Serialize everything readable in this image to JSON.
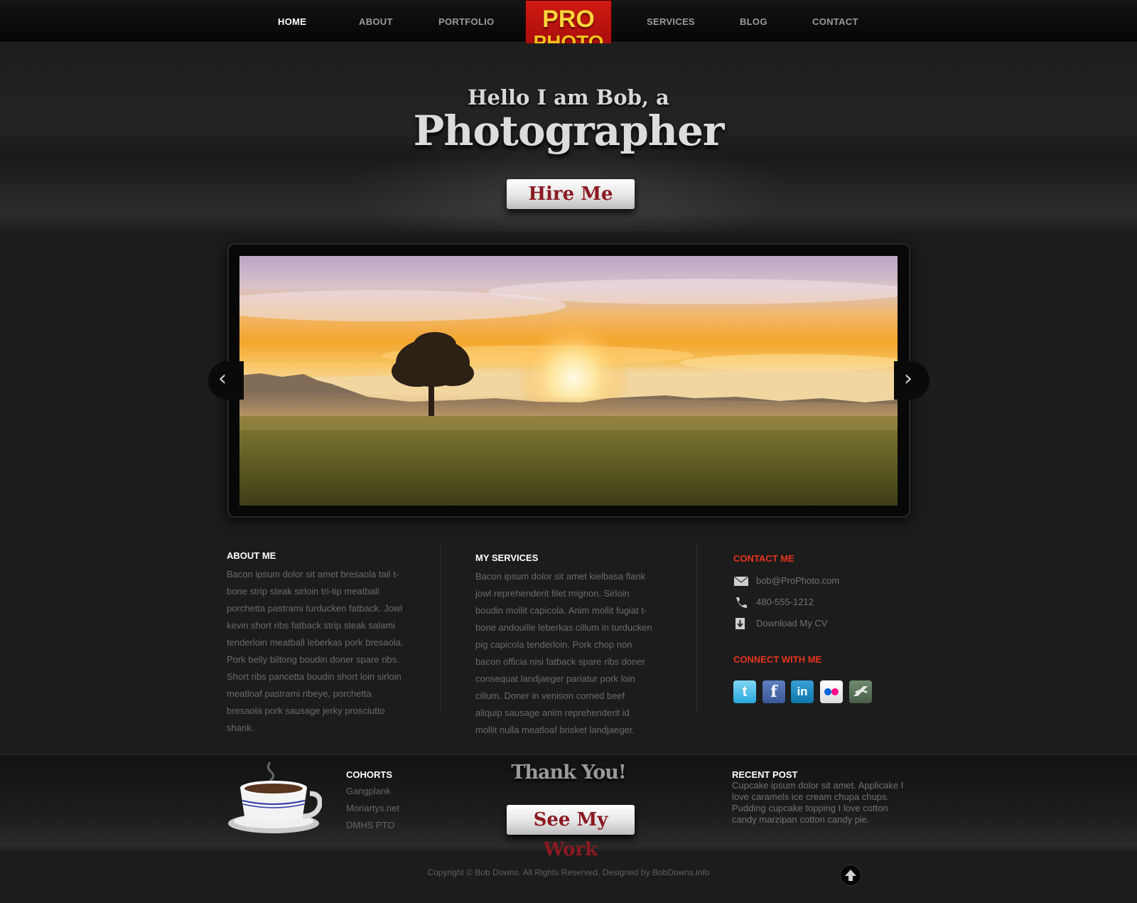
{
  "nav": {
    "items": [
      {
        "label": "HOME"
      },
      {
        "label": "ABOUT"
      },
      {
        "label": "PORTFOLIO"
      },
      {
        "label": "SERVICES"
      },
      {
        "label": "BLOG"
      },
      {
        "label": "CONTACT"
      }
    ],
    "active": "HOME"
  },
  "logo": {
    "line1": "PRO",
    "line2": "PHOTO"
  },
  "hero": {
    "line1": "Hello I am Bob, a",
    "line2": "Photographer",
    "cta": "Hire Me"
  },
  "slider": {
    "prev_icon": "chevron-left-icon",
    "next_icon": "chevron-right-icon"
  },
  "about": {
    "heading": "ABOUT ME",
    "text": "Bacon ipsum dolor sit amet bresaola tail t-bone strip steak sirloin tri-tip meatball porchetta pastrami turducken fatback. Jowl kevin short ribs fatback strip steak salami tenderloin meatball leberkas pork bresaola. Pork belly biltong boudin doner spare ribs. Short ribs pancetta boudin short loin sirloin meatloaf pastrami ribeye, porchetta bresaola pork sausage jerky prosciutto shank."
  },
  "services": {
    "heading": "MY SERVICES",
    "text": "Bacon ipsum dolor sit amet kielbasa flank jowl reprehenderit filet mignon. Sirloin boudin mollit capicola. Anim mollit fugiat t-bone andouille leberkas cillum in turducken pig capicola tenderloin. Pork chop non bacon officia nisi fatback spare ribs doner consequat landjaeger pariatur pork loin cillum. Doner in venison corned beef aliquip sausage anim reprehenderit id mollit nulla meatloaf brisket landjaeger."
  },
  "contact": {
    "heading": "CONTACT ME",
    "email": "bob@ProPhoto.com",
    "phone": "480-555-1212",
    "cv": "Download My CV",
    "connect_heading": "CONNECT WITH ME",
    "social": [
      "twitter-icon",
      "facebook-icon",
      "linkedin-icon",
      "flickr-icon",
      "deviantart-icon"
    ]
  },
  "footer": {
    "cohorts_heading": "COHORTS",
    "cohorts": [
      "Gangplank",
      "Moriartys.net",
      "DMHS PTO"
    ],
    "thanks": "Thank You!",
    "cta": "See My Work",
    "recent_heading": "RECENT POST",
    "recent_text": "Cupcake ipsum dolor sit amet. Applicake I love caramels ice cream chupa chups. Pudding cupcake topping I love cotton candy marzipan cotton candy pie.",
    "copyright": "Copyright © Bob Downs. All Rights Reserved. Designed by BobDowns.info"
  },
  "colors": {
    "accent_red": "#e8331d",
    "button_text": "#8c1a23",
    "logo_gold": "#f6c21c"
  }
}
